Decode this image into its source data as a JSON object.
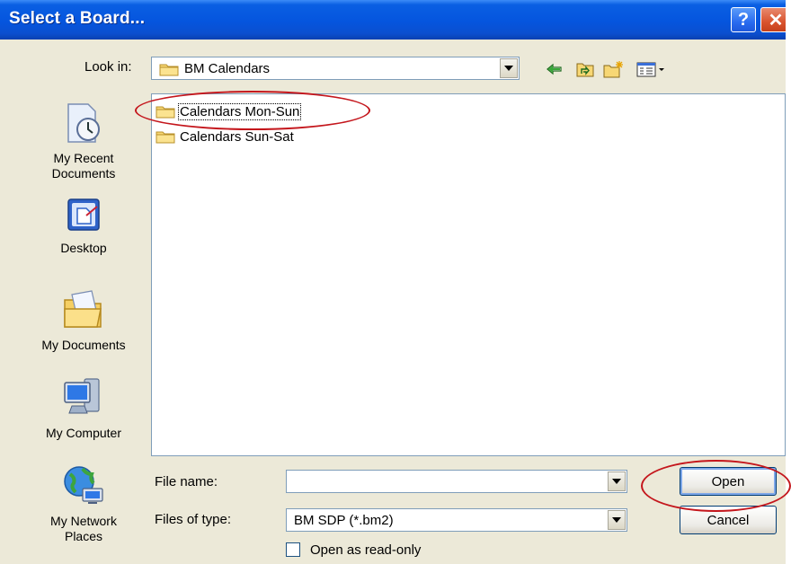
{
  "window": {
    "title": "Select a Board...",
    "help_label": "?",
    "close_label": "✕"
  },
  "look_in": {
    "label": "Look in:",
    "value": "BM Calendars"
  },
  "places": [
    {
      "label": "My Recent\nDocuments"
    },
    {
      "label": "Desktop"
    },
    {
      "label": "My Documents"
    },
    {
      "label": "My Computer"
    },
    {
      "label": "My Network\nPlaces"
    }
  ],
  "files": [
    {
      "name": "Calendars Mon-Sun"
    },
    {
      "name": "Calendars Sun-Sat"
    }
  ],
  "file_name": {
    "label": "File name:",
    "value": ""
  },
  "file_type": {
    "label": "Files of type:",
    "value": "BM SDP (*.bm2)"
  },
  "buttons": {
    "open": "Open",
    "cancel": "Cancel"
  },
  "read_only": {
    "label": "Open as read-only",
    "checked": false
  },
  "colors": {
    "title_bar": "#0555de",
    "dialog_bg": "#ece9d8",
    "annotation": "#c4161c"
  }
}
